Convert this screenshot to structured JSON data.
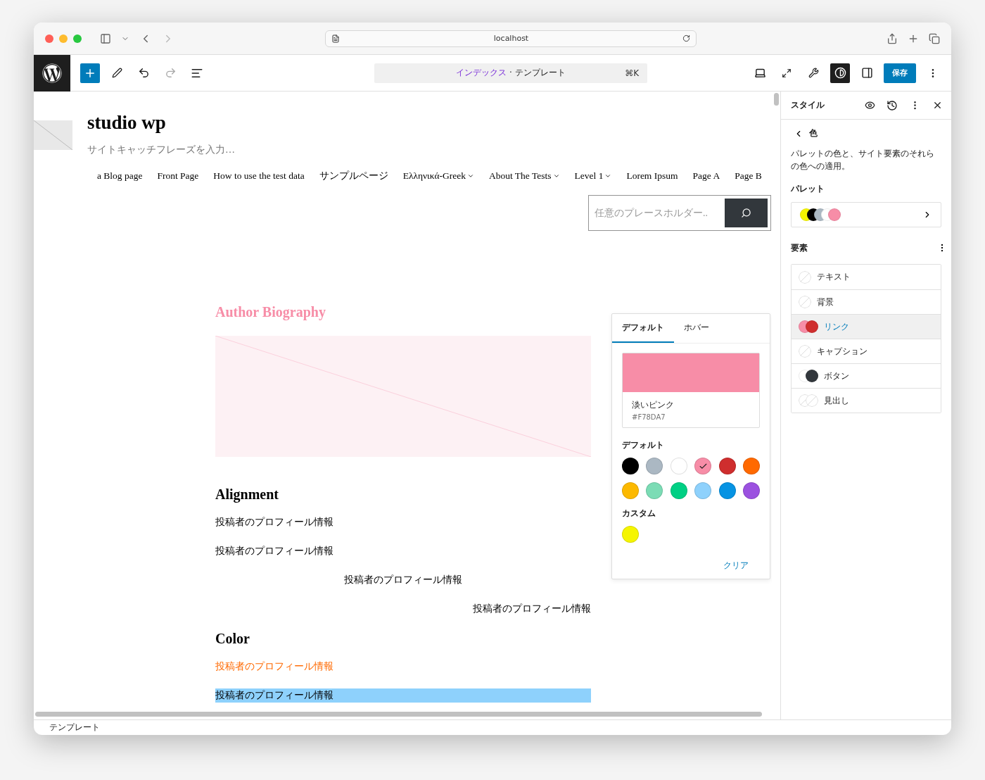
{
  "browser": {
    "url": "localhost"
  },
  "toolbar": {
    "command_title": "インデックス",
    "command_suffix": " · テンプレート",
    "shortcut": "⌘K",
    "styles_active": true,
    "save": "保存"
  },
  "site": {
    "title": "studio wp",
    "tagline": "サイトキャッチフレーズを入力…",
    "nav": [
      {
        "label": "a Blog page",
        "has_submenu": false
      },
      {
        "label": "Front Page",
        "has_submenu": false
      },
      {
        "label": "How to use the test data",
        "has_submenu": false
      },
      {
        "label": "サンプルページ",
        "has_submenu": false
      },
      {
        "label": "Ελληνικά-Greek",
        "has_submenu": true
      },
      {
        "label": "About The Tests",
        "has_submenu": true
      },
      {
        "label": "Level 1",
        "has_submenu": true
      },
      {
        "label": "Lorem Ipsum",
        "has_submenu": false
      },
      {
        "label": "Page A",
        "has_submenu": false
      },
      {
        "label": "Page B",
        "has_submenu": false
      }
    ],
    "search": {
      "placeholder": "任意のプレースホルダー.."
    }
  },
  "content": [
    {
      "kind": "heading",
      "text": "Author Biography",
      "color": "#f78da7"
    },
    {
      "kind": "image"
    },
    {
      "kind": "heading",
      "text": "Alignment"
    },
    {
      "kind": "paragraph",
      "text": "投稿者のプロフィール情報",
      "centered": false,
      "right_aligned": false
    },
    {
      "kind": "paragraph",
      "text": "投稿者のプロフィール情報",
      "centered": false,
      "right_aligned": false
    },
    {
      "kind": "paragraph",
      "text": "投稿者のプロフィール情報",
      "centered": true,
      "right_aligned": false
    },
    {
      "kind": "paragraph",
      "text": "投稿者のプロフィール情報",
      "centered": false,
      "right_aligned": true
    },
    {
      "kind": "heading",
      "text": "Color"
    },
    {
      "kind": "paragraph",
      "text": "投稿者のプロフィール情報",
      "centered": false,
      "right_aligned": false,
      "color": "#ff6900"
    },
    {
      "kind": "highlight",
      "text": "投稿者のプロフィール情報",
      "color": "#8ed1fc"
    }
  ],
  "popover": {
    "tabs": [
      {
        "label": "デフォルト",
        "selected": true
      },
      {
        "label": "ホバー",
        "selected": false
      }
    ],
    "current": {
      "name": "淡いピンク",
      "hex": "#F78DA7",
      "color": "#f78da7"
    },
    "groups": [
      {
        "label": "デフォルト",
        "swatches": [
          {
            "color": "#000000",
            "selected": false
          },
          {
            "color": "#abb8c3",
            "selected": false
          },
          {
            "color": "#ffffff",
            "selected": false
          },
          {
            "color": "#f78da7",
            "selected": true
          },
          {
            "color": "#cf2e2e",
            "selected": false
          },
          {
            "color": "#ff6900",
            "selected": false
          },
          {
            "color": "#fcb900",
            "selected": false
          },
          {
            "color": "#7bdcb5",
            "selected": false
          },
          {
            "color": "#00d084",
            "selected": false
          },
          {
            "color": "#8ed1fc",
            "selected": false
          },
          {
            "color": "#0693e3",
            "selected": false
          },
          {
            "color": "#9b51e0",
            "selected": false
          }
        ]
      },
      {
        "label": "カスタム",
        "swatches": [
          {
            "color": "#f5f500",
            "selected": false
          }
        ]
      }
    ],
    "clear": "クリア"
  },
  "sidebar": {
    "title": "スタイル",
    "back_title": "色",
    "description": "パレットの色と、サイト要素のそれらの色への適用。",
    "palette_label": "パレット",
    "palette": [
      {
        "color": "#f5f500"
      },
      {
        "color": "#000000"
      },
      {
        "color": "#abb8c3"
      },
      {
        "color": "#ffffff"
      },
      {
        "color": "#f78da7"
      }
    ],
    "elements_label": "要素",
    "elements": [
      {
        "label": "テキスト",
        "swatches": [
          {
            "kind": "empty"
          }
        ],
        "selected": false
      },
      {
        "label": "背景",
        "swatches": [
          {
            "kind": "empty"
          }
        ],
        "selected": false
      },
      {
        "label": "リンク",
        "swatches": [
          {
            "kind": "color",
            "color": "#f78da7"
          },
          {
            "kind": "color",
            "color": "#cf2e2e"
          }
        ],
        "selected": true
      },
      {
        "label": "キャプション",
        "swatches": [
          {
            "kind": "empty"
          }
        ],
        "selected": false
      },
      {
        "label": "ボタン",
        "swatches": [
          {
            "kind": "color",
            "color": "#ffffff"
          },
          {
            "kind": "color",
            "color": "#32373c"
          }
        ],
        "selected": false
      },
      {
        "label": "見出し",
        "swatches": [
          {
            "kind": "empty"
          },
          {
            "kind": "empty"
          }
        ],
        "selected": false
      }
    ]
  },
  "status_bar": "テンプレート"
}
